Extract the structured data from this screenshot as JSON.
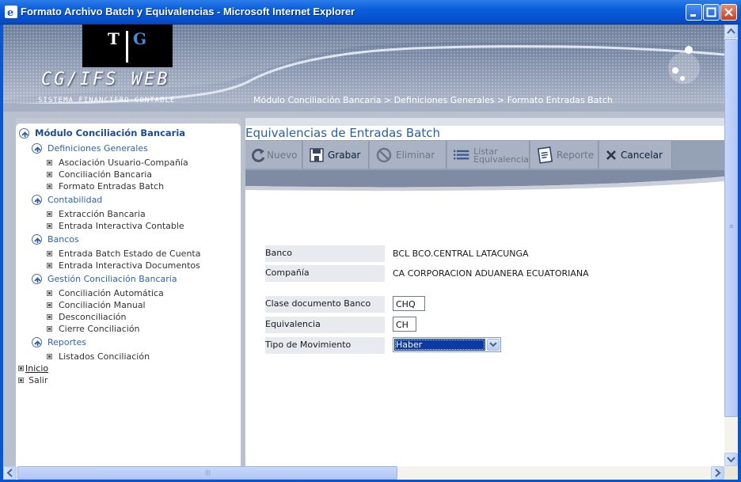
{
  "window": {
    "title": "Formato Archivo Batch y Equivalencias - Microsoft Internet Explorer",
    "icon": "ie-icon",
    "controls": [
      "minimize-icon",
      "maximize-icon",
      "close-icon"
    ]
  },
  "header": {
    "logo_left": "T",
    "logo_right": "G",
    "brand": "CG/IFS WEB",
    "brand_sub": "SISTEMA FINANCIERO CONTABLE",
    "breadcrumb": "Módulo Conciliación Bancaria > Definiciones Generales > Formato Entradas Batch"
  },
  "sidebar": {
    "module": "Módulo Conciliación Bancaria",
    "sections": [
      {
        "label": "Definiciones Generales",
        "items": [
          "Asociación Usuario-Compañía",
          "Conciliación Bancaria",
          "Formato Entradas Batch"
        ]
      },
      {
        "label": "Contabilidad",
        "items": [
          "Extracción Bancaria",
          "Entrada Interactiva Contable"
        ]
      },
      {
        "label": "Bancos",
        "items": [
          "Entrada Batch Estado de Cuenta",
          "Entrada Interactiva Documentos"
        ]
      },
      {
        "label": "Gestión Conciliación Bancaria",
        "items": [
          "Conciliación Automática",
          "Conciliación Manual",
          "Desconciliación",
          "Cierre Conciliación"
        ]
      },
      {
        "label": "Reportes",
        "items": [
          "Listados Conciliación"
        ]
      }
    ],
    "footer": [
      "Inicio",
      "Salir"
    ]
  },
  "main": {
    "title": "Equivalencias de Entradas Batch",
    "toolbar": {
      "nuevo": "Nuevo",
      "grabar": "Grabar",
      "eliminar": "Eliminar",
      "listar_1": "Listar",
      "listar_2": "Equivalencia",
      "reporte": "Reporte",
      "cancelar": "Cancelar"
    },
    "form": {
      "banco_label": "Banco",
      "banco_value": "BCL BCO.CENTRAL LATACUNGA",
      "compania_label": "Compañía",
      "compania_value": "CA CORPORACION ADUANERA ECUATORIANA",
      "clase_label": "Clase documento Banco",
      "clase_value": "CHQ",
      "equivalencia_label": "Equivalencia",
      "equivalencia_value": "CH",
      "tipo_label": "Tipo de Movimiento",
      "tipo_value": "Haber"
    }
  },
  "colors": {
    "title_bar": "#0a5ed9",
    "section_link": "#2c64b9",
    "page_title": "#2660ad",
    "selection": "#0b3aa8"
  }
}
